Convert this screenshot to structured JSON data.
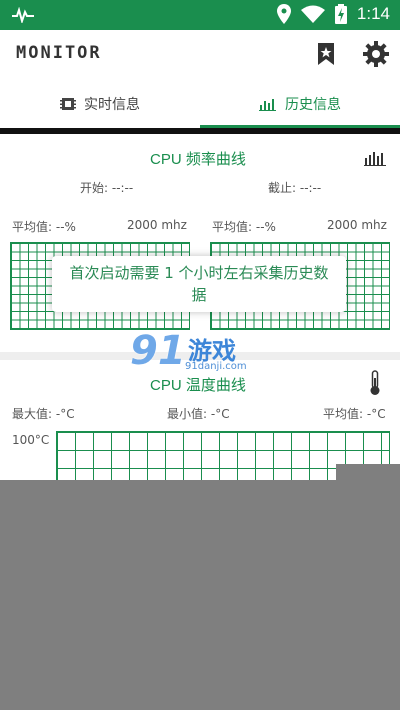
{
  "status_bar": {
    "time": "1:14"
  },
  "app_bar": {
    "title": "MONITOR"
  },
  "tabs": [
    {
      "label": "实时信息"
    },
    {
      "label": "历史信息"
    }
  ],
  "freq_section": {
    "title": "CPU 频率曲线",
    "start_label": "开始: --:--",
    "end_label": "截止: --:--",
    "avg_left": "平均值: --%",
    "mhz_left": "2000 mhz",
    "avg_right": "平均值: --%",
    "mhz_right": "2000 mhz"
  },
  "toast": {
    "text": "首次启动需要 1 个小时左右采集历史数据"
  },
  "temp_section": {
    "title": "CPU 温度曲线",
    "max_label": "最大值: -°C",
    "min_label": "最小值: -°C",
    "avg_label": "平均值: -°C",
    "y_label": "100°C"
  },
  "watermark": {
    "number": "91",
    "brand": "游戏",
    "url": "91danji.com"
  },
  "colors": {
    "accent": "#1a8e4e",
    "grey_overlay": "#7f7f7f"
  }
}
